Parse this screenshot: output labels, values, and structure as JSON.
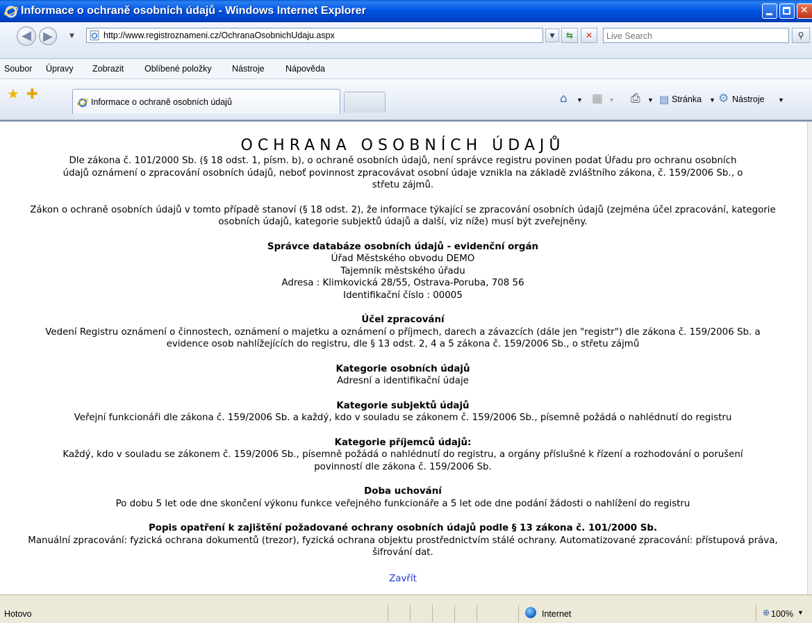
{
  "window": {
    "title": "Informace o ochraně osobních údajů - Windows Internet Explorer"
  },
  "address": {
    "url": "http://www.registroznameni.cz/OchranaOsobnichUdaju.aspx",
    "search_placeholder": "Live Search"
  },
  "menu": {
    "items": [
      "Soubor",
      "Úpravy",
      "Zobrazit",
      "Oblíbené položky",
      "Nástroje",
      "Nápověda"
    ]
  },
  "tabs": {
    "active_label": "Informace o ochraně osobních údajů"
  },
  "command_bar": {
    "page_label": "Stránka",
    "tools_label": "Nástroje"
  },
  "content": {
    "title": "OCHRANA OSOBNÍCH ÚDAJŮ",
    "intro_p1": "Dle zákona č. 101/2000 Sb. (§ 18 odst. 1, písm. b), o ochraně osobních údajů, není správce registru povinen podat Úřadu pro ochranu osobních údajů oznámení o zpracování osobních údajů, neboť povinnost zpracovávat osobní údaje vznikla na základě zvláštního zákona, č. 159/2006 Sb., o střetu zájmů.",
    "intro_p2": "Zákon o ochraně osobních údajů v tomto případě stanoví (§ 18 odst. 2), že informace týkající se zpracování osobních údajů (zejména účel zpracování, kategorie osobních údajů, kategorie subjektů údajů a další, viz níže) musí být zveřejněny.",
    "admin": {
      "title": "Správce databáze osobních údajů - evidenční orgán",
      "office": "Úřad Městského obvodu DEMO",
      "secretary": "Tajemník městského úřadu",
      "address": "Adresa : Klimkovická 28/55, Ostrava-Poruba, 708 56",
      "id": "Identifikační číslo : 00005"
    },
    "purpose": {
      "title": "Účel zpracování",
      "text": "Vedení Registru oznámení o činnostech, oznámení o majetku a oznámení o příjmech, darech a závazcích (dále jen \"registr\") dle zákona č. 159/2006 Sb. a evidence osob nahlížejících do registru, dle § 13 odst. 2, 4 a 5 zákona č. 159/2006 Sb., o střetu zájmů"
    },
    "data_categories": {
      "title": "Kategorie osobních údajů",
      "text": "Adresní a identifikační údaje"
    },
    "subject_categories": {
      "title": "Kategorie subjektů údajů",
      "text": "Veřejní funkcionáři dle zákona č. 159/2006 Sb. a každý, kdo v souladu se zákonem č. 159/2006 Sb., písemně požádá o nahlédnutí do registru"
    },
    "recipient_categories": {
      "title": "Kategorie příjemců údajů:",
      "text": "Každý, kdo v souladu se zákonem č. 159/2006 Sb., písemně požádá o nahlédnutí do registru, a orgány příslušné k řízení a rozhodování o porušení povinností dle zákona č. 159/2006 Sb."
    },
    "retention": {
      "title": "Doba uchování",
      "text": "Po dobu 5 let ode dne skončení výkonu funkce veřejného funkcionáře a 5 let ode dne podání žádosti o nahlížení do registru"
    },
    "measures": {
      "title": "Popis opatření k zajištění požadované ochrany osobních údajů podle § 13 zákona č. 101/2000 Sb.",
      "text": "Manuální zpracování: fyzická ochrana dokumentů (trezor), fyzická ochrana objektu prostřednictvím stálé ochrany. Automatizované zpracování: přístupová práva, šifrování dat."
    },
    "close_link": "Zavřít"
  },
  "status": {
    "text": "Hotovo",
    "zone": "Internet",
    "zoom": "100%"
  },
  "colors": {
    "titlebar": "#0054e3",
    "link": "#1d37d6"
  }
}
